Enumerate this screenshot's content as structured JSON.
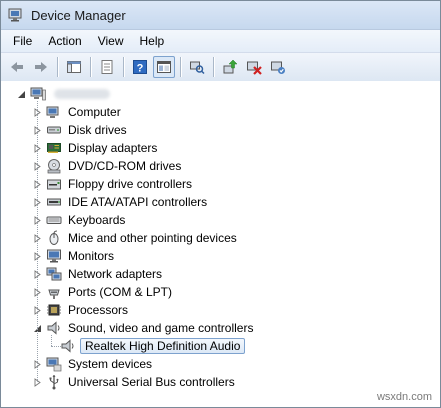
{
  "window": {
    "title": "Device Manager"
  },
  "menu": [
    "File",
    "Action",
    "View",
    "Help"
  ],
  "toolbar": {
    "buttons": [
      "back-icon",
      "forward-icon",
      "console-tree-icon",
      "properties-icon",
      "help-icon",
      "show-hide-pane-icon",
      "scan-hardware-icon",
      "update-driver-icon",
      "uninstall-icon",
      "enable-device-icon"
    ]
  },
  "tree": {
    "root_label": "",
    "categories": [
      {
        "label": "Computer",
        "icon": "computer-icon"
      },
      {
        "label": "Disk drives",
        "icon": "disk-drive-icon"
      },
      {
        "label": "Display adapters",
        "icon": "display-adapter-icon"
      },
      {
        "label": "DVD/CD-ROM drives",
        "icon": "dvd-drive-icon"
      },
      {
        "label": "Floppy drive controllers",
        "icon": "floppy-controller-icon"
      },
      {
        "label": "IDE ATA/ATAPI controllers",
        "icon": "ide-controller-icon"
      },
      {
        "label": "Keyboards",
        "icon": "keyboard-icon"
      },
      {
        "label": "Mice and other pointing devices",
        "icon": "mouse-icon"
      },
      {
        "label": "Monitors",
        "icon": "monitor-icon"
      },
      {
        "label": "Network adapters",
        "icon": "network-adapter-icon"
      },
      {
        "label": "Ports (COM & LPT)",
        "icon": "port-icon"
      },
      {
        "label": "Processors",
        "icon": "processor-icon"
      },
      {
        "label": "Sound, video and game controllers",
        "icon": "speaker-icon",
        "expanded": true
      },
      {
        "label": "Realtek High Definition Audio",
        "icon": "speaker-icon",
        "child": true,
        "selected": true
      },
      {
        "label": "System devices",
        "icon": "system-device-icon"
      },
      {
        "label": "Universal Serial Bus controllers",
        "icon": "usb-icon"
      }
    ]
  },
  "watermark": "wsxdn.com",
  "colors": {
    "selection_border": "#7da2ce",
    "selection_fill": "#dce8f6",
    "titlebar": "#c6d8ee"
  }
}
